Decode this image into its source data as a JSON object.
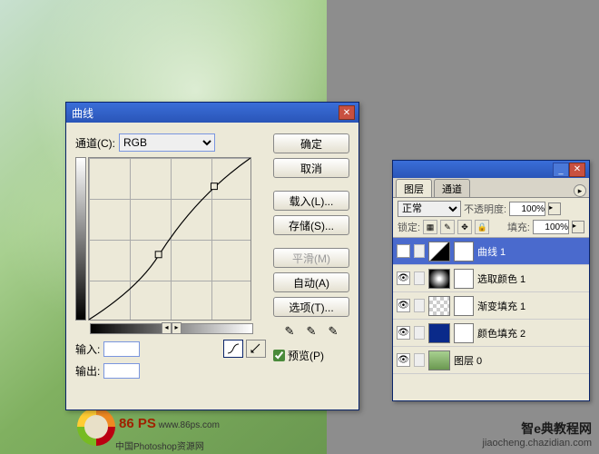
{
  "curves": {
    "title": "曲线",
    "channel_label": "通道(C):",
    "channel_value": "RGB",
    "input_label": "输入:",
    "output_label": "输出:",
    "buttons": {
      "ok": "确定",
      "cancel": "取消",
      "load": "载入(L)...",
      "save": "存储(S)...",
      "smooth": "平滑(M)",
      "auto": "自动(A)",
      "options": "选项(T)..."
    },
    "preview_label": "预览(P)"
  },
  "layers": {
    "tabs": {
      "layers": "图层",
      "channels": "通道"
    },
    "blend_mode": "正常",
    "opacity_label": "不透明度:",
    "opacity_value": "100%",
    "lock_label": "锁定:",
    "fill_label": "填充:",
    "fill_value": "100%",
    "items": [
      {
        "name": "曲线 1",
        "kind": "curves",
        "selected": true
      },
      {
        "name": "选取颜色 1",
        "kind": "gradient",
        "selected": false
      },
      {
        "name": "渐变填充 1",
        "kind": "checker",
        "selected": false
      },
      {
        "name": "颜色填充 2",
        "kind": "blue",
        "selected": false
      },
      {
        "name": "图层 0",
        "kind": "img",
        "selected": false
      }
    ]
  },
  "watermark": {
    "brand": "86 PS",
    "url": "www.86ps.com",
    "subtitle": "中国Photoshop资源网",
    "footer_main": "智e典教程网",
    "footer_url": "jiaocheng.chazidian.com"
  }
}
